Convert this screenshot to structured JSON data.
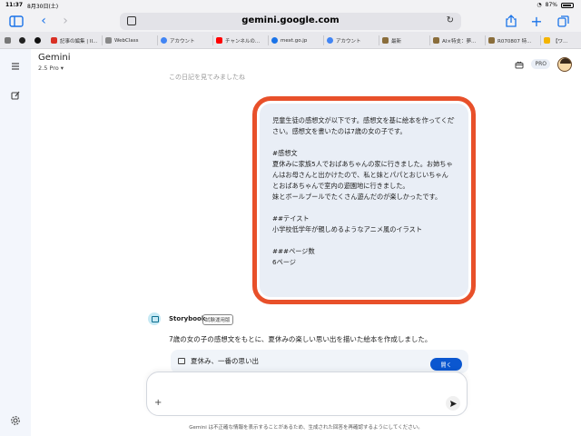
{
  "status": {
    "time": "11:37",
    "date": "8月30日(土)",
    "battery": "87%"
  },
  "browser": {
    "url": "gemini.google.com"
  },
  "tabs": [
    {
      "label": "",
      "color": "#777777"
    },
    {
      "label": "",
      "color": "#222222"
    },
    {
      "label": "記事の編集 | II...",
      "color": "#d93025"
    },
    {
      "label": "WebClass",
      "color": "#888888"
    },
    {
      "label": "アカウント",
      "color": "#4285f4"
    },
    {
      "label": "チャンネルの...",
      "color": "#ff0000"
    },
    {
      "label": "mext.go.jp",
      "color": "#1a73e8"
    },
    {
      "label": "アカウント",
      "color": "#4285f4"
    },
    {
      "label": "最新",
      "color": "#8a6d3b"
    },
    {
      "label": "AI×特支：夢...",
      "color": "#8a6d3b"
    },
    {
      "label": "R070807 特...",
      "color": "#8a6d3b"
    },
    {
      "label": "【ワ...",
      "color": "#f4b400"
    }
  ],
  "header": {
    "title": "Gemini",
    "model": "2.5 Pro",
    "pro_label": "PRO"
  },
  "prev_text": "この日記を見てみましたね",
  "prompt": {
    "text": "児童生徒の感想文が以下です。感想文を基に絵本を作ってください。感想文を書いたのは7歳の女の子です。\n\n#感想文\n夏休みに家族5人でおばあちゃんの家に行きました。お姉ちゃんはお母さんと出かけたので、私と妹とパパとおじいちゃんとおばあちゃんで室内の遊園地に行きました。\n妹とボールプールでたくさん遊んだのが楽しかったです。\n\n##テイスト\n小学校低学年が親しめるようなアニメ風のイラスト\n\n###ページ数\n6ページ",
    "highlight_color": "#e8502a"
  },
  "response": {
    "name": "Storybook",
    "badge": "試験運用版",
    "text": "7歳の女の子の感想文をもとに、夏休みの楽しい思い出を描いた絵本を作成しました。",
    "card_title": "夏休み、一番の思い出",
    "open_label": "開く"
  },
  "input": {
    "placeholder": ""
  },
  "disclaimer": "Gemini は不正確な情報を表示することがあるため、生成された回答を再確認するようにしてください。",
  "colors": {
    "accent": "#0b57d0",
    "bubble": "#e9eef6",
    "rail": "#f3f6fc"
  }
}
